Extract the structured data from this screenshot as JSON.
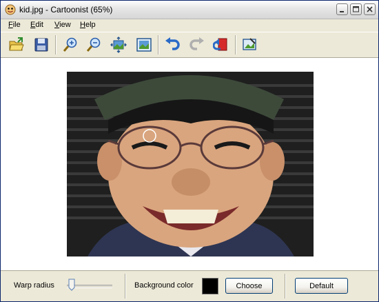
{
  "window": {
    "title": "kid.jpg - Cartoonist (65%)"
  },
  "menu": [
    {
      "label": "File"
    },
    {
      "label": "Edit"
    },
    {
      "label": "View"
    },
    {
      "label": "Help"
    }
  ],
  "toolbar": {
    "tools": [
      "open-folder-icon",
      "save-icon",
      "zoom-in-icon",
      "zoom-out-icon",
      "fit-to-window-icon",
      "actual-size-icon",
      "undo-icon",
      "redo-icon",
      "reset-icon",
      "export-image-icon"
    ]
  },
  "controls": {
    "warp_radius_label": "Warp radius",
    "warp_radius_value": 0.1,
    "background_color_label": "Background color",
    "background_color": "#000000",
    "choose_label": "Choose",
    "default_label": "Default"
  },
  "colors": {
    "title_text": "#000000",
    "accent_border": "#003C74"
  }
}
